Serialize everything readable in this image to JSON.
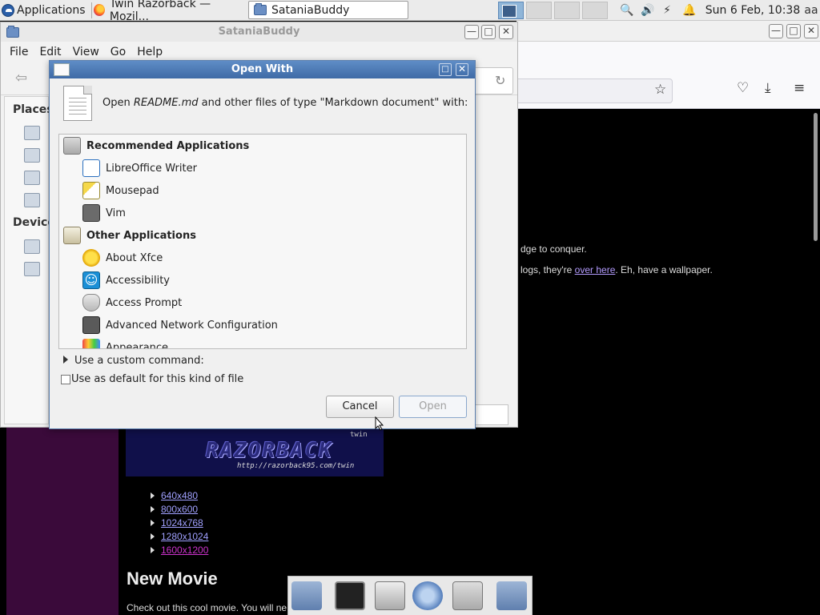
{
  "panel": {
    "apps_label": "Applications",
    "tasks": [
      {
        "label": "Twin Razorback — Mozil..."
      },
      {
        "label": "SataniaBuddy"
      }
    ],
    "clock": "Sun  6 Feb, 10:38",
    "user": "aa"
  },
  "file_manager": {
    "title": "SataniaBuddy",
    "menu": [
      "File",
      "Edit",
      "View",
      "Go",
      "Help"
    ],
    "sidebar_places": "Places",
    "sidebar_devices": "Device"
  },
  "dialog": {
    "title": "Open With",
    "prompt_prefix": "Open ",
    "prompt_file": "README.md",
    "prompt_suffix": " and other files of type \"Markdown document\" with:",
    "recommended_header": "Recommended Applications",
    "recommended": [
      "LibreOffice Writer",
      "Mousepad",
      "Vim"
    ],
    "other_header": "Other Applications",
    "other": [
      "About Xfce",
      "Accessibility",
      "Access Prompt",
      "Advanced Network Configuration",
      "Appearance"
    ],
    "custom_command_label": "Use a custom command:",
    "default_label": "Use as default for this kind of file",
    "cancel": "Cancel",
    "open": "Open"
  },
  "browser_page": {
    "text_line1": "dge to conquer.",
    "text_line2_pre": "logs, they're ",
    "text_line2_link": "over here",
    "text_line2_post": ". Eh, have a wallpaper.",
    "banner_twin": "twin",
    "banner_title": "RAZORBACK",
    "banner_url": "http://razorback95.com/twin",
    "resolutions": [
      "640x480",
      "800x600",
      "1024x768",
      "1280x1024",
      "1600x1200"
    ],
    "movie_heading": "New Movie",
    "movie_text": "Check out this cool movie. You will ne"
  },
  "colors": {
    "dialog_title": "#3e6aa6",
    "link": "#a0a0ff",
    "visited_link": "#cc33cc",
    "purple_sidebar": "#3a0a3a"
  }
}
